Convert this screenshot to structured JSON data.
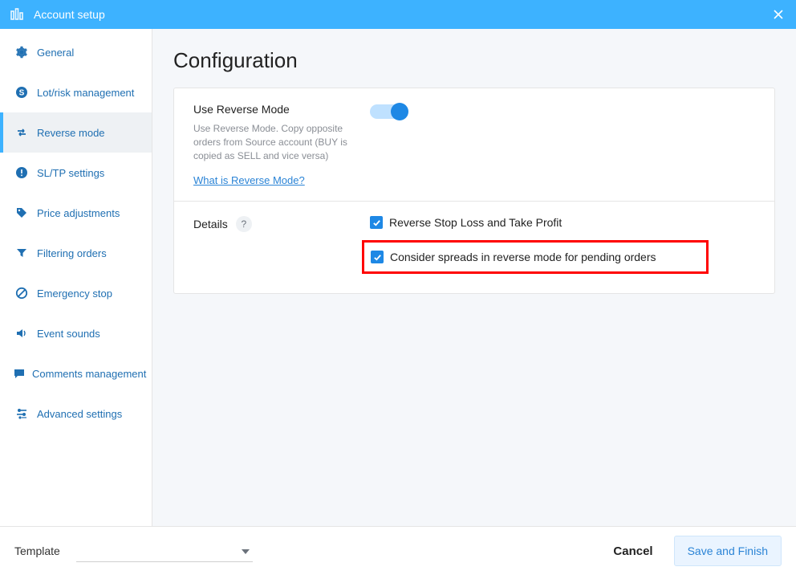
{
  "titlebar": {
    "title": "Account setup"
  },
  "sidebar": {
    "items": [
      {
        "label": "General",
        "icon": "gear-icon",
        "id": "general"
      },
      {
        "label": "Lot/risk management",
        "icon": "dollar-icon",
        "id": "lot-risk"
      },
      {
        "label": "Reverse mode",
        "icon": "reverse-icon",
        "id": "reverse-mode",
        "active": true
      },
      {
        "label": "SL/TP settings",
        "icon": "alert-icon",
        "id": "sltp"
      },
      {
        "label": "Price adjustments",
        "icon": "tag-icon",
        "id": "price-adj"
      },
      {
        "label": "Filtering orders",
        "icon": "funnel-icon",
        "id": "filtering"
      },
      {
        "label": "Emergency stop",
        "icon": "noentry-icon",
        "id": "estop"
      },
      {
        "label": "Event sounds",
        "icon": "volume-icon",
        "id": "sounds"
      },
      {
        "label": "Comments management",
        "icon": "comment-icon",
        "id": "comments"
      },
      {
        "label": "Advanced settings",
        "icon": "sliders-icon",
        "id": "advanced"
      }
    ]
  },
  "content": {
    "heading": "Configuration",
    "reverse": {
      "title": "Use Reverse Mode",
      "description": "Use Reverse Mode. Copy opposite orders from Source account (BUY is copied as SELL and vice versa)",
      "link_text": "What is Reverse Mode?",
      "enabled": true
    },
    "details": {
      "label": "Details",
      "options": [
        {
          "label": "Reverse Stop Loss and Take Profit",
          "checked": true,
          "highlight": false
        },
        {
          "label": "Consider spreads in reverse mode for pending orders",
          "checked": true,
          "highlight": true
        }
      ]
    }
  },
  "footer": {
    "template_label": "Template",
    "cancel": "Cancel",
    "save": "Save and Finish"
  }
}
